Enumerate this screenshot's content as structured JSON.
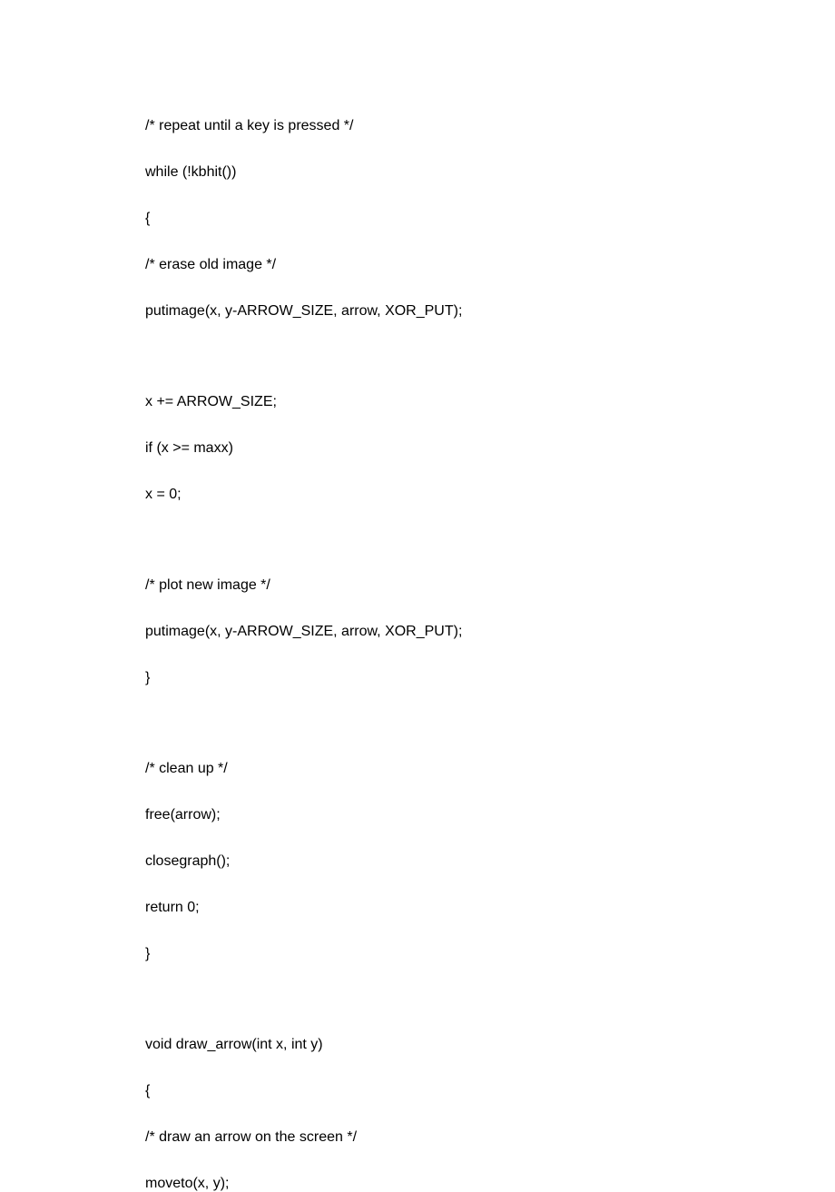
{
  "lines": [
    {
      "text": "/* repeat until a key is pressed */",
      "extraGap": false
    },
    {
      "text": "while (!kbhit())",
      "extraGap": false
    },
    {
      "text": "{",
      "extraGap": false
    },
    {
      "text": "/* erase old image */",
      "extraGap": false
    },
    {
      "text": "putimage(x, y-ARROW_SIZE, arrow, XOR_PUT);",
      "extraGap": true
    },
    {
      "text": "x += ARROW_SIZE;",
      "extraGap": false
    },
    {
      "text": "if (x >= maxx)",
      "extraGap": false
    },
    {
      "text": "x = 0;",
      "extraGap": true
    },
    {
      "text": "/* plot new image */",
      "extraGap": false
    },
    {
      "text": "putimage(x, y-ARROW_SIZE, arrow, XOR_PUT);",
      "extraGap": false
    },
    {
      "text": "}",
      "extraGap": true
    },
    {
      "text": "/* clean up */",
      "extraGap": false
    },
    {
      "text": "free(arrow);",
      "extraGap": false
    },
    {
      "text": "closegraph();",
      "extraGap": false
    },
    {
      "text": "return 0;",
      "extraGap": false
    },
    {
      "text": "}",
      "extraGap": true
    },
    {
      "text": "void draw_arrow(int x, int y)",
      "extraGap": false
    },
    {
      "text": "{",
      "extraGap": false
    },
    {
      "text": "/* draw an arrow on the screen */",
      "extraGap": false
    },
    {
      "text": "moveto(x, y);",
      "extraGap": false
    }
  ]
}
